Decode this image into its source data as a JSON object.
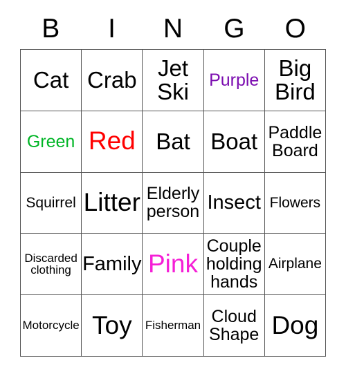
{
  "card": {
    "title": "BINGO",
    "headers": [
      "B",
      "I",
      "N",
      "G",
      "O"
    ],
    "colors": {
      "text": "#000000",
      "grid_line": "#555555",
      "background": "#FFFFFF",
      "purple": "#7B0DB0",
      "green": "#00B526",
      "red": "#FF0000",
      "magenta": "#F51FD6"
    },
    "rows": [
      [
        {
          "label": "Cat",
          "color": "black",
          "size": "xl"
        },
        {
          "label": "Crab",
          "color": "black",
          "size": "xl"
        },
        {
          "label": "Jet\nSki",
          "color": "black",
          "size": "xl"
        },
        {
          "label": "Purple",
          "color": "purple",
          "size": "md"
        },
        {
          "label": "Big\nBird",
          "color": "black",
          "size": "xl"
        }
      ],
      [
        {
          "label": "Green",
          "color": "green",
          "size": "md"
        },
        {
          "label": "Red",
          "color": "red",
          "size": "xxl"
        },
        {
          "label": "Bat",
          "color": "black",
          "size": "xl"
        },
        {
          "label": "Boat",
          "color": "black",
          "size": "xl"
        },
        {
          "label": "Paddle\nBoard",
          "color": "black",
          "size": "md"
        }
      ],
      [
        {
          "label": "Squirrel",
          "color": "black",
          "size": "sm"
        },
        {
          "label": "Litter",
          "color": "black",
          "size": "xxl"
        },
        {
          "label": "Elderly\nperson",
          "color": "black",
          "size": "md"
        },
        {
          "label": "Insect",
          "color": "black",
          "size": "lg"
        },
        {
          "label": "Flowers",
          "color": "black",
          "size": "sm"
        }
      ],
      [
        {
          "label": "Discarded\nclothing",
          "color": "black",
          "size": "xs"
        },
        {
          "label": "Family",
          "color": "black",
          "size": "lg"
        },
        {
          "label": "Pink",
          "color": "magenta",
          "size": "xxl"
        },
        {
          "label": "Couple\nholding\nhands",
          "color": "black",
          "size": "md"
        },
        {
          "label": "Airplane",
          "color": "black",
          "size": "sm"
        }
      ],
      [
        {
          "label": "Motorcycle",
          "color": "black",
          "size": "xs"
        },
        {
          "label": "Toy",
          "color": "black",
          "size": "xxl"
        },
        {
          "label": "Fisherman",
          "color": "black",
          "size": "xs"
        },
        {
          "label": "Cloud\nShape",
          "color": "black",
          "size": "md"
        },
        {
          "label": "Dog",
          "color": "black",
          "size": "xxl"
        }
      ]
    ]
  }
}
